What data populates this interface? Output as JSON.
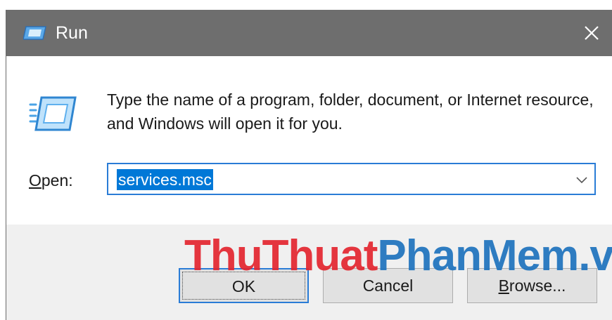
{
  "window": {
    "title": "Run",
    "icons": {
      "title": "run-icon",
      "close": "close-icon",
      "program": "run-program-icon",
      "dropdown": "chevron-down-icon"
    }
  },
  "content": {
    "description": "Type the name of a program, folder, document, or Internet resource, and Windows will open it for you.",
    "open_label_mnemonic": "O",
    "open_label_rest": "pen:",
    "open_input_value": "services.msc"
  },
  "buttons": {
    "ok_label": "OK",
    "cancel_label": "Cancel",
    "browse_mnemonic": "B",
    "browse_rest": "rowse..."
  },
  "watermark": {
    "part1": "ThuThuat",
    "part2": "PhanMem.vn"
  },
  "colors": {
    "titlebar": "#6e6e6e",
    "accent": "#0078d7",
    "watermark_red": "#e3262f",
    "watermark_blue": "#1e73be"
  }
}
